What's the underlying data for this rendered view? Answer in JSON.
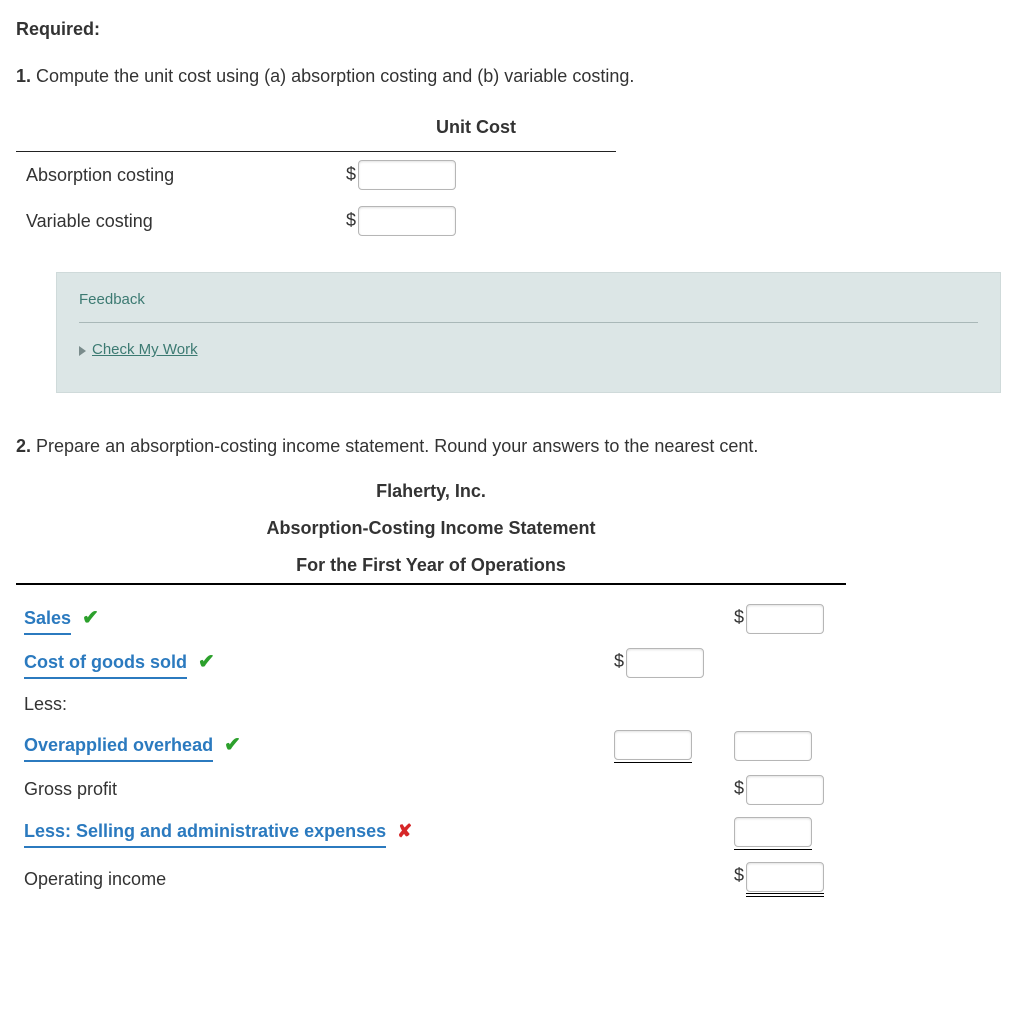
{
  "required_label": "Required:",
  "q1": {
    "num": "1.",
    "text": "Compute the unit cost using (a) absorption costing and (b) variable costing.",
    "table_header": "Unit Cost",
    "rows": [
      {
        "label": "Absorption costing",
        "prefix": "$"
      },
      {
        "label": "Variable costing",
        "prefix": "$"
      }
    ]
  },
  "feedback": {
    "title": "Feedback",
    "link": "Check My Work"
  },
  "q2": {
    "num": "2.",
    "text": "Prepare an absorption-costing income statement. Round your answers to the nearest cent.",
    "header": {
      "company": "Flaherty, Inc.",
      "title": "Absorption-Costing Income Statement",
      "period": "For the First Year of Operations"
    },
    "rows": {
      "sales": {
        "label": "Sales",
        "status": "correct",
        "prefix_b": "$"
      },
      "cogs": {
        "label": "Cost of goods sold",
        "status": "correct",
        "prefix_a": "$"
      },
      "less": {
        "label": "Less:"
      },
      "overapplied": {
        "label": "Overapplied overhead",
        "status": "correct"
      },
      "gross": {
        "label": "Gross profit",
        "prefix_b": "$"
      },
      "sga": {
        "label": "Less: Selling and administrative expenses",
        "status": "wrong"
      },
      "opincome": {
        "label": "Operating income",
        "prefix_b": "$"
      }
    }
  }
}
